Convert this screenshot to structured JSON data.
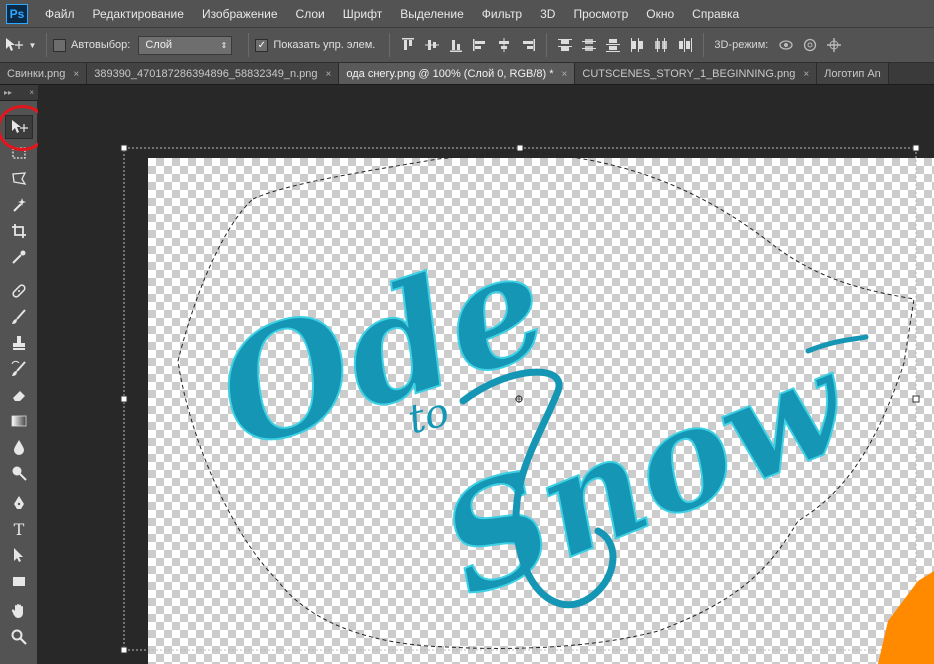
{
  "app": {
    "logo": "Ps",
    "menu": [
      "Файл",
      "Редактирование",
      "Изображение",
      "Слои",
      "Шрифт",
      "Выделение",
      "Фильтр",
      "3D",
      "Просмотр",
      "Окно",
      "Справка"
    ]
  },
  "options": {
    "auto_select_label": "Автовыбор:",
    "auto_select_checked": false,
    "layer_select_value": "Слой",
    "show_transform_label": "Показать упр. элем.",
    "show_transform_checked": true,
    "mode_3d_label": "3D-режим:"
  },
  "tabs": [
    {
      "label": "Свинки.png",
      "active": false
    },
    {
      "label": "389390_470187286394896_58832349_n.png",
      "active": false
    },
    {
      "label": "ода снегу.png @ 100% (Слой 0, RGB/8) *",
      "active": true
    },
    {
      "label": "CUTSCENES_STORY_1_BEGINNING.png",
      "active": false
    },
    {
      "label": "Логотип An",
      "active": false
    }
  ],
  "tab_close_glyph": "×",
  "tools_panel": {
    "collapse_glyph": "▸▸",
    "close_glyph": "×",
    "tools": [
      "move",
      "marquee",
      "lasso",
      "magic-wand",
      "crop",
      "eyedropper",
      "healing",
      "brush",
      "clone-stamp",
      "history-brush",
      "eraser",
      "gradient",
      "blur",
      "dodge",
      "pen",
      "type",
      "path-selection",
      "rectangle",
      "hand",
      "zoom"
    ],
    "active_tool": "move",
    "type_tool_glyph": "T"
  },
  "document": {
    "artwork_text": {
      "line1": "Ode",
      "line2": "to",
      "line3": "Snow"
    },
    "artwork_color": "#1596b5",
    "artwork_highlight": "#3fd0e4"
  },
  "colors": {
    "ps_blue": "#31a8ff",
    "annotation_red": "#e4161b",
    "accent_orange": "#ff8a00"
  }
}
